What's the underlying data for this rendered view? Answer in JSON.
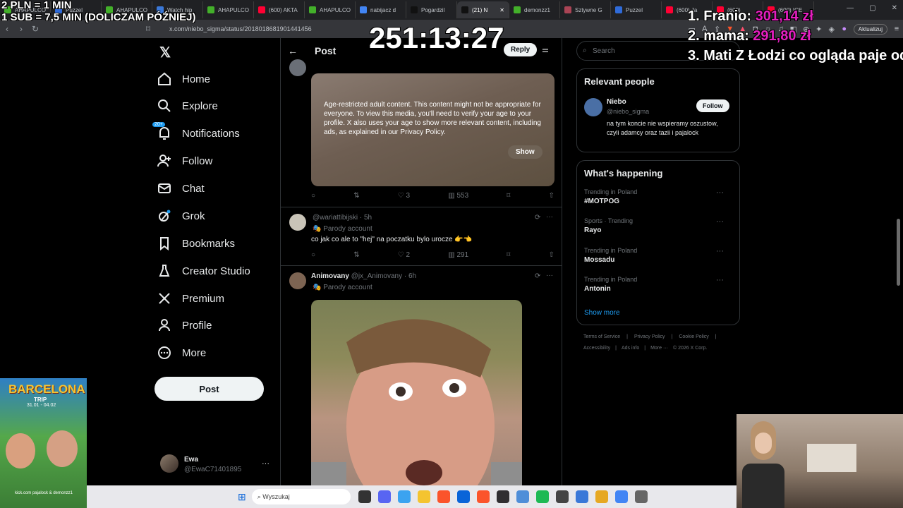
{
  "browser": {
    "tabs": [
      {
        "label": "AHAPULCO",
        "color": "#43b02a",
        "active": false
      },
      {
        "label": "Puzzel",
        "color": "#2f6bd9",
        "active": false
      },
      {
        "label": "AHAPULCO",
        "color": "#43b02a",
        "active": false
      },
      {
        "label": "Watch hip",
        "color": "#3a78d8",
        "active": false
      },
      {
        "label": "AHAPULCO",
        "color": "#43b02a",
        "active": false
      },
      {
        "label": "(600) AKTA",
        "color": "#ff0033",
        "active": false
      },
      {
        "label": "AHAPULCO",
        "color": "#43b02a",
        "active": false
      },
      {
        "label": "nabijacz d",
        "color": "#4285f4",
        "active": false
      },
      {
        "label": "Pogardzil",
        "color": "#111111",
        "active": false
      },
      {
        "label": "(21) N",
        "color": "#111111",
        "active": true
      },
      {
        "label": "demonzz1",
        "color": "#43b02a",
        "active": false
      },
      {
        "label": "Sztywne G",
        "color": "#aa4455",
        "active": false
      },
      {
        "label": "Puzzel",
        "color": "#2f6bd9",
        "active": false
      },
      {
        "label": "(600) Ja",
        "color": "#ff0033",
        "active": false
      },
      {
        "label": "(600)",
        "color": "#ff0033",
        "active": false
      },
      {
        "label": "(600) ICE",
        "color": "#ff0033",
        "active": false
      }
    ],
    "url": "x.com/niebo_sigma/status/2018018681901441456",
    "update_label": "Aktualizuj"
  },
  "overlay": {
    "rate_line1": "2 PLN = 1 MIN",
    "rate_line2": "1 SUB = 7,5 MIN (DOLICZAM PÓŹNIEJ)",
    "timer": "251:13:27",
    "leaderboard": [
      {
        "rank": "1.",
        "name": "Franio:",
        "amount": "301,14 zł"
      },
      {
        "rank": "2.",
        "name": "mama:",
        "amount": "291,80 zł"
      },
      {
        "rank": "3.",
        "name": "Mati Z Łodzi co ogląda paje od",
        "amount": ""
      }
    ]
  },
  "nav": {
    "items": [
      {
        "label": "Home",
        "icon": "home-icon"
      },
      {
        "label": "Explore",
        "icon": "search-icon"
      },
      {
        "label": "Notifications",
        "icon": "bell-icon",
        "badge": "20+"
      },
      {
        "label": "Follow",
        "icon": "add-person-icon"
      },
      {
        "label": "Chat",
        "icon": "mail-icon"
      },
      {
        "label": "Grok",
        "icon": "grok-icon"
      },
      {
        "label": "Bookmarks",
        "icon": "bookmark-icon"
      },
      {
        "label": "Creator Studio",
        "icon": "flask-icon"
      },
      {
        "label": "Premium",
        "icon": "x-logo-icon"
      },
      {
        "label": "Profile",
        "icon": "person-icon"
      },
      {
        "label": "More",
        "icon": "more-circle-icon"
      }
    ],
    "post_label": "Post",
    "account": {
      "name": "Ewa",
      "handle": "@EwaC71401895"
    }
  },
  "header": {
    "title": "Post",
    "reply_label": "Reply"
  },
  "posts": [
    {
      "warning": "Age-restricted adult content. This content might not be appropriate for everyone. To view this media, you'll need to verify your age to your profile. X also uses your age to show more relevant content, including ads, as explained in our Privacy Policy.",
      "show_label": "Show",
      "likes": "3",
      "views": "553"
    },
    {
      "handle": "@wariattibijski",
      "time": "· 5h",
      "parody": "Parody account",
      "text": "co jak co ale to \"hej\" na poczatku bylo urocze 👉👈",
      "likes": "2",
      "views": "291"
    },
    {
      "name": "Animovany",
      "handle": "@jx_Animovany",
      "time": "· 6h",
      "parody": "Parody account"
    }
  ],
  "sidebar": {
    "search_placeholder": "Search",
    "relevant_title": "Relevant people",
    "person": {
      "name": "Niebo",
      "handle": "@niebo_sigma",
      "follow_label": "Follow",
      "bio": "na tym koncie nie wspieramy oszustow, czyli adamcy oraz tazii i pajalock"
    },
    "happening_title": "What's happening",
    "trends": [
      {
        "category": "Trending in Poland",
        "name": "#MOTPOG"
      },
      {
        "category": "Sports · Trending",
        "name": "Rayo"
      },
      {
        "category": "Trending in Poland",
        "name": "Mossadu"
      },
      {
        "category": "Trending in Poland",
        "name": "Antonin"
      }
    ],
    "show_more": "Show more",
    "footer_line1": [
      "Terms of Service",
      "|",
      "Privacy Policy",
      "|",
      "Cookie Policy",
      "|"
    ],
    "footer_line2": [
      "Accessibility",
      "|",
      "Ads info",
      "|",
      "More ···",
      "© 2026 X Corp."
    ]
  },
  "taskbar": {
    "search_placeholder": "Wyszukaj"
  },
  "promo": {
    "title": "BARCELONA",
    "subtitle": "TRIP",
    "dates": "31.01 - 04.02",
    "bottom": "kick.com pajalock & demonzz1"
  }
}
